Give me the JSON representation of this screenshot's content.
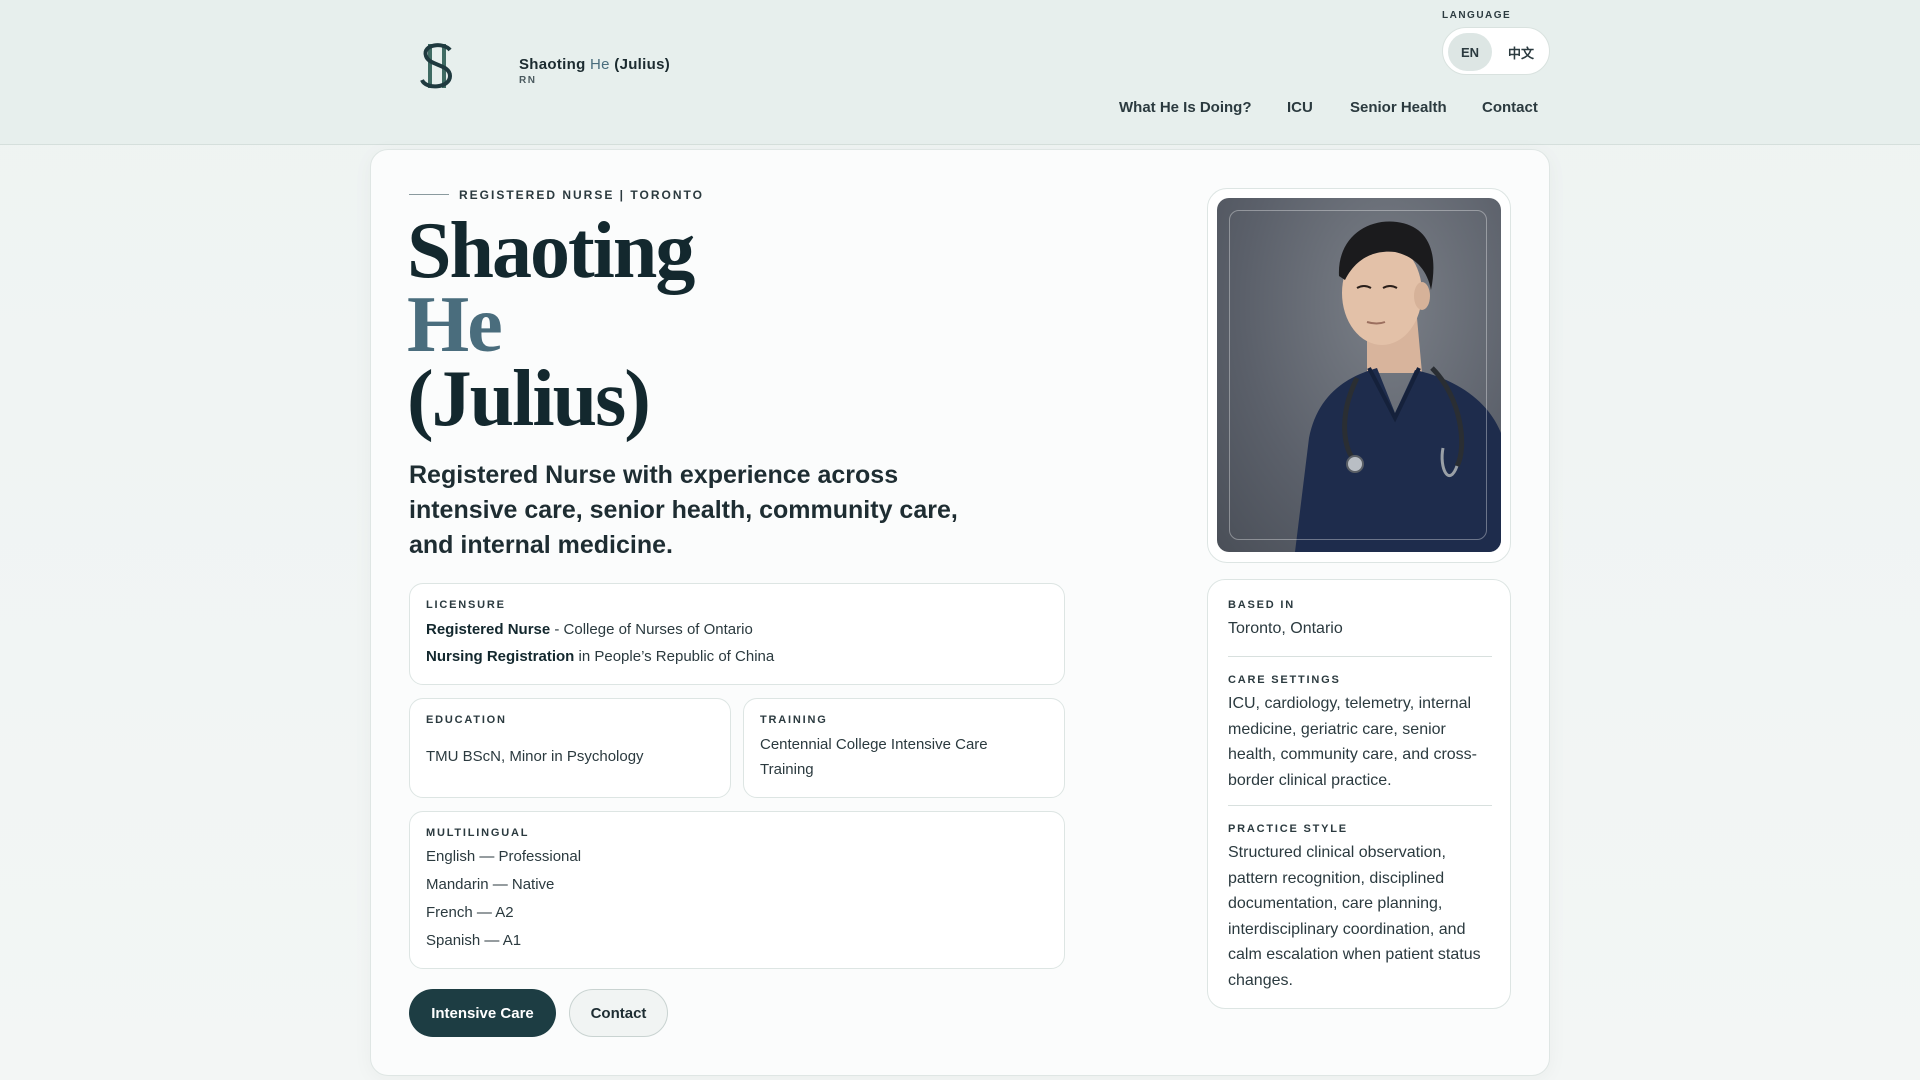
{
  "header": {
    "brand_name_first": "Shaoting",
    "brand_name_accent": "He",
    "brand_name_last": "(Julius)",
    "brand_credential": "RN",
    "language_label": "LANGUAGE",
    "languages": [
      {
        "label": "EN",
        "selected": true
      },
      {
        "label": "中文",
        "selected": false
      }
    ],
    "nav": [
      {
        "label": "What He Is Doing?"
      },
      {
        "label": "ICU"
      },
      {
        "label": "Senior Health"
      },
      {
        "label": "Contact"
      }
    ]
  },
  "hero": {
    "eyebrow": "REGISTERED NURSE | TORONTO",
    "name_line1": "Shaoting",
    "name_line2": "He",
    "name_line3": "(Julius)",
    "tagline": "Registered Nurse with experience across intensive care, senior health, community care, and internal medicine."
  },
  "licensure": {
    "label": "LICENSURE",
    "items": [
      {
        "title": "Registered Nurse",
        "detail": " - College of Nurses of Ontario"
      },
      {
        "title": "Nursing Registration",
        "detail": " in People’s Republic of China"
      }
    ]
  },
  "education": {
    "label": "EDUCATION",
    "text": "TMU BScN, Minor in Psychology"
  },
  "training": {
    "label": "TRAINING",
    "text": "Centennial College Intensive Care Training"
  },
  "multilingual": {
    "label": "MULTILINGUAL",
    "items": [
      "English — Professional",
      "Mandarin — Native",
      "French — A2",
      "Spanish — A1"
    ]
  },
  "actions": {
    "primary_label": "Intensive Care",
    "secondary_label": "Contact"
  },
  "sidebar": {
    "based_in_label": "BASED IN",
    "based_in_text": "Toronto, Ontario",
    "care_settings_label": "CARE SETTINGS",
    "care_settings_text": "ICU, cardiology, telemetry, internal medicine, geriatric care, senior health, community care, and cross-border clinical practice.",
    "practice_style_label": "PRACTICE STYLE",
    "practice_style_text": "Structured clinical observation, pattern recognition, disciplined documentation, care planning, interdisciplinary coordination, and calm escalation when patient status changes."
  },
  "colors": {
    "primary": "#1d3d43",
    "accent": "#4a6d7d",
    "header_bg": "#e7efed"
  }
}
